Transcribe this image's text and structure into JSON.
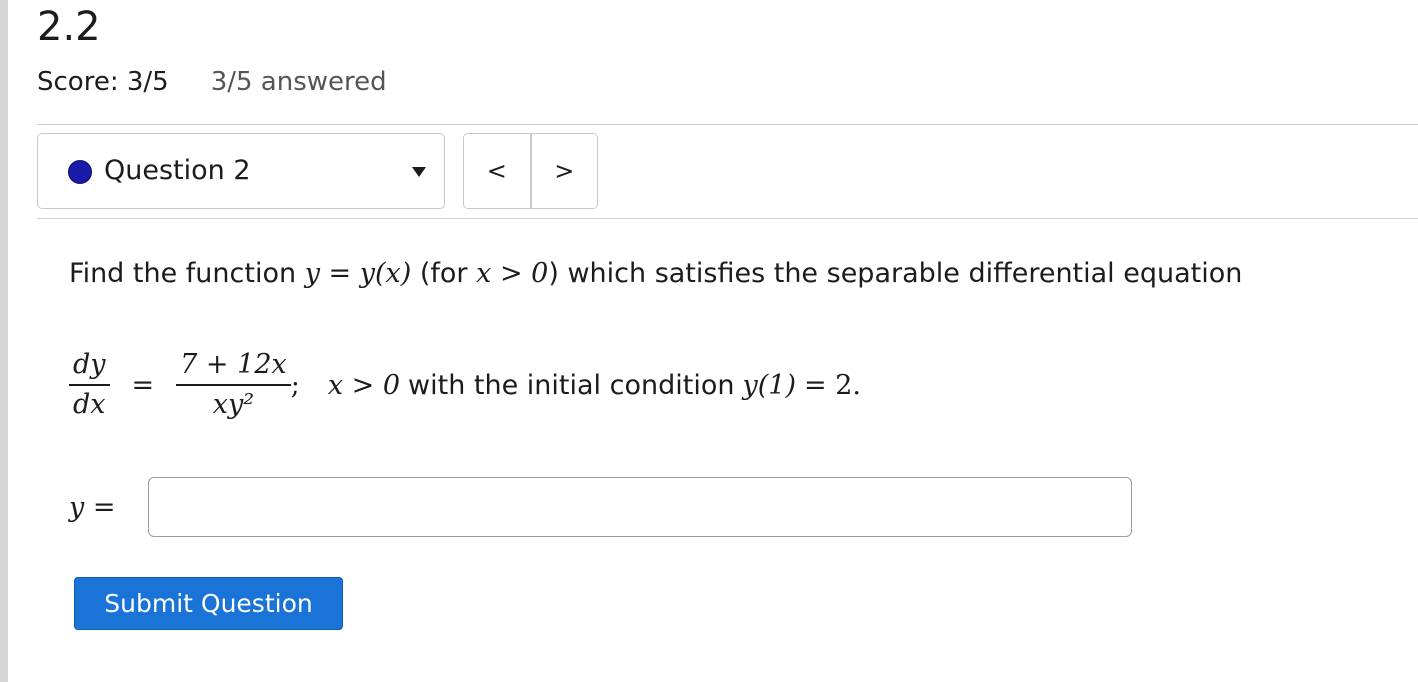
{
  "header": {
    "assignment_title": "2.2",
    "score": "Score: 3/5",
    "answered": "3/5 answered"
  },
  "question_nav": {
    "selected_question": "Question 2",
    "prev_label": "<",
    "next_label": ">",
    "status_color": "#1a1aa8"
  },
  "question": {
    "prompt_before": "Find the function",
    "prompt_fn": "y = y(x)",
    "prompt_for_open": "(for",
    "prompt_cond": "x > 0",
    "prompt_after": ") which satisfies the separable differential equation",
    "deriv_num": "dy",
    "deriv_den": "dx",
    "equals": "=",
    "rhs_num": "7 + 12x",
    "rhs_den": "xy²",
    "semicolon": ";",
    "domain_cond": "x > 0",
    "initial_text": "with the initial condition",
    "initial_cond": "y(1)",
    "initial_value": "= 2."
  },
  "answer": {
    "label": "y =",
    "value": "",
    "placeholder": ""
  },
  "actions": {
    "submit_label": "Submit Question",
    "submit_color": "#1a73d6"
  }
}
